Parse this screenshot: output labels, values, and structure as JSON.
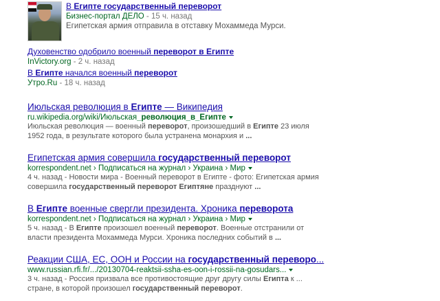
{
  "news": {
    "item1": {
      "title_pre": "В ",
      "title_b1": "Египте",
      "title_b2": " государственный переворот",
      "source": "Бизнес-портал ДЕЛО",
      "time": " - 15 ч. назад",
      "snippet": "Египетская армия отправила в отставку Мохаммеда Мурси."
    },
    "item2": {
      "title_pre": "Духовенство одобрило военный ",
      "title_b": "переворот в Египте",
      "source": "InVictory.org",
      "time": " - 2 ч. назад"
    },
    "item3": {
      "title_pre": "В ",
      "title_b1": "Египте",
      "title_mid": " начался военный ",
      "title_b2": "переворот",
      "source": "Утро.Ru",
      "time": " - 18 ч. назад"
    }
  },
  "results": [
    {
      "title_pre": "Июльская революция в ",
      "title_b": "Египте",
      "title_post": " — Википедия",
      "url_pre": "ru.wikipedia.org/wiki/Июльская",
      "url_b": "_революция_в_Египте",
      "snip1_pre": "Июльская революция — военный ",
      "snip1_b1": "переворот",
      "snip1_mid": ", произошедший в ",
      "snip1_b2": "Египте",
      "snip1_post": " 23 июля",
      "snip2_pre": "1952 года, в результате которого была устранена монархия и ",
      "snip2_b": "..."
    },
    {
      "title_pre": "Египетская армия совершила ",
      "title_b": "государственный переворот",
      "url": "korrespondent.net",
      "crumbs": [
        "Подписаться на журнал",
        "Украина",
        "Мир"
      ],
      "snip1": "4 ч. назад - Новости мира - Военный переворот в Египте - фото: Египетская армия",
      "snip2_pre": "совершила ",
      "snip2_b1": "государственный переворот Египтяне",
      "snip2_mid": " празднуют ",
      "snip2_b2": "..."
    },
    {
      "title_pre": "В ",
      "title_b1": "Египте",
      "title_mid": " военные свергли президента. Хроника ",
      "title_b2": "переворота",
      "url": "korrespondent.net",
      "crumbs": [
        "Подписаться на журнал",
        "Украина",
        "Мир"
      ],
      "snip1_pre": "5 ч. назад - В ",
      "snip1_b1": "Египте",
      "snip1_mid": " произошел военный ",
      "snip1_b2": "переворот",
      "snip1_post": ". Военные отстранили от",
      "snip2_pre": "власти президента Мохаммеда Мурси. Хроника последних событий в ",
      "snip2_b": "..."
    },
    {
      "title_pre": "Реакции США, ЕС, ООН и России на ",
      "title_b": "государственный переворо",
      "title_post": "...",
      "url": "www.russian.rfi.fr/.../20130704-reaktsii-ssha-es-oon-i-rossii-na-gosudars...",
      "snip1_pre": "3 ч. назад - Россия призвала все противостоящие друг другу силы ",
      "snip1_b": "Египта",
      "snip1_post": " к ...",
      "snip2_pre": "стране, в которой произошел ",
      "snip2_b": "государственный переворот",
      "snip2_post": "."
    }
  ],
  "sep": " › "
}
